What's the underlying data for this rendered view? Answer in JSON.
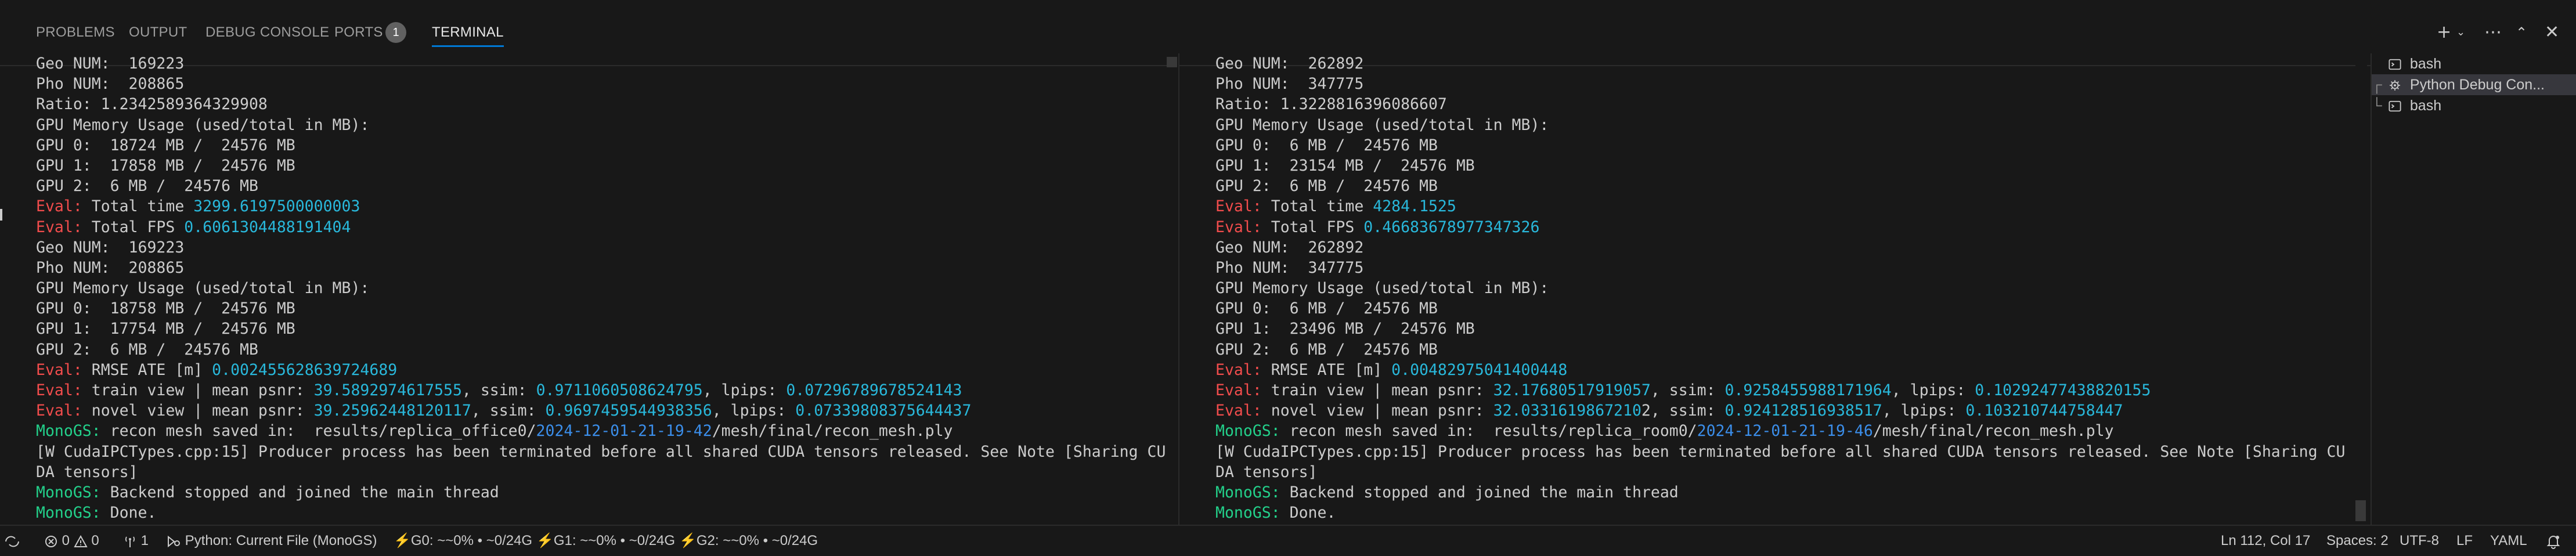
{
  "panel": {
    "tabs": [
      {
        "label": "PROBLEMS"
      },
      {
        "label": "OUTPUT"
      },
      {
        "label": "DEBUG CONSOLE"
      },
      {
        "label": "PORTS"
      },
      {
        "label": "TERMINAL"
      }
    ],
    "ports_badge": "1",
    "active_tab": "TERMINAL"
  },
  "terminal_left": {
    "lines": [
      {
        "segments": [
          {
            "text": "Geo NUM:  169223",
            "color": "default"
          }
        ]
      },
      {
        "segments": [
          {
            "text": "Pho NUM:  208865",
            "color": "default"
          }
        ]
      },
      {
        "segments": [
          {
            "text": "Ratio: 1.2342589364329908",
            "color": "default"
          }
        ]
      },
      {
        "segments": [
          {
            "text": "GPU Memory Usage (used/total in MB):",
            "color": "default"
          }
        ]
      },
      {
        "segments": [
          {
            "text": "GPU 0:  18724 MB /  24576 MB",
            "color": "default"
          }
        ]
      },
      {
        "segments": [
          {
            "text": "GPU 1:  17858 MB /  24576 MB",
            "color": "default"
          }
        ]
      },
      {
        "segments": [
          {
            "text": "GPU 2:  6 MB /  24576 MB",
            "color": "default"
          }
        ]
      },
      {
        "segments": [
          {
            "text": "Eval:",
            "color": "red"
          },
          {
            "text": " Total time ",
            "color": "default"
          },
          {
            "text": "3299.6197500000003",
            "color": "cyan"
          }
        ]
      },
      {
        "segments": [
          {
            "text": "Eval:",
            "color": "red"
          },
          {
            "text": " Total FPS ",
            "color": "default"
          },
          {
            "text": "0.6061304488191404",
            "color": "cyan"
          }
        ]
      },
      {
        "segments": [
          {
            "text": "Geo NUM:  169223",
            "color": "default"
          }
        ]
      },
      {
        "segments": [
          {
            "text": "Pho NUM:  208865",
            "color": "default"
          }
        ]
      },
      {
        "segments": [
          {
            "text": "GPU Memory Usage (used/total in MB):",
            "color": "default"
          }
        ]
      },
      {
        "segments": [
          {
            "text": "GPU 0:  18758 MB /  24576 MB",
            "color": "default"
          }
        ]
      },
      {
        "segments": [
          {
            "text": "GPU 1:  17754 MB /  24576 MB",
            "color": "default"
          }
        ]
      },
      {
        "segments": [
          {
            "text": "GPU 2:  6 MB /  24576 MB",
            "color": "default"
          }
        ]
      },
      {
        "segments": [
          {
            "text": "Eval:",
            "color": "red"
          },
          {
            "text": " RMSE ATE [m] ",
            "color": "default"
          },
          {
            "text": "0.002455628639724689",
            "color": "cyan"
          }
        ]
      },
      {
        "segments": [
          {
            "text": "Eval:",
            "color": "red"
          },
          {
            "text": " train view | mean psnr: ",
            "color": "default"
          },
          {
            "text": "39.5892974617555",
            "color": "cyan"
          },
          {
            "text": ", ssim: ",
            "color": "default"
          },
          {
            "text": "0.9711060508624795",
            "color": "cyan"
          },
          {
            "text": ", lpips: ",
            "color": "default"
          },
          {
            "text": "0.07296789678524143",
            "color": "cyan"
          }
        ]
      },
      {
        "segments": [
          {
            "text": "Eval:",
            "color": "red"
          },
          {
            "text": " novel view | mean psnr: ",
            "color": "default"
          },
          {
            "text": "39.25962448120117",
            "color": "cyan"
          },
          {
            "text": ", ssim: ",
            "color": "default"
          },
          {
            "text": "0.9697459544938356",
            "color": "cyan"
          },
          {
            "text": ", lpips: ",
            "color": "default"
          },
          {
            "text": "0.07339808375644437",
            "color": "cyan"
          }
        ]
      },
      {
        "segments": [
          {
            "text": "MonoGS:",
            "color": "green"
          },
          {
            "text": " recon mesh saved in:  results/replica_office0/",
            "color": "default"
          },
          {
            "text": "2024-12-01-21-19-42",
            "color": "blue"
          },
          {
            "text": "/mesh/final/recon_mesh.ply",
            "color": "default"
          }
        ]
      },
      {
        "segments": [
          {
            "text": "[W CudaIPCTypes.cpp:15] Producer process has been terminated before all shared CUDA tensors released. See Note [Sharing CU",
            "color": "default"
          }
        ]
      },
      {
        "segments": [
          {
            "text": "DA tensors]",
            "color": "default"
          }
        ]
      },
      {
        "segments": [
          {
            "text": "MonoGS:",
            "color": "green"
          },
          {
            "text": " Backend stopped and joined the main thread",
            "color": "default"
          }
        ]
      },
      {
        "segments": [
          {
            "text": "MonoGS:",
            "color": "green"
          },
          {
            "text": " Done.",
            "color": "default"
          }
        ]
      }
    ]
  },
  "terminal_right": {
    "lines": [
      {
        "segments": [
          {
            "text": "Geo NUM:  262892",
            "color": "default"
          }
        ]
      },
      {
        "segments": [
          {
            "text": "Pho NUM:  347775",
            "color": "default"
          }
        ]
      },
      {
        "segments": [
          {
            "text": "Ratio: 1.3228816396086607",
            "color": "default"
          }
        ]
      },
      {
        "segments": [
          {
            "text": "GPU Memory Usage (used/total in MB):",
            "color": "default"
          }
        ]
      },
      {
        "segments": [
          {
            "text": "GPU 0:  6 MB /  24576 MB",
            "color": "default"
          }
        ]
      },
      {
        "segments": [
          {
            "text": "GPU 1:  23154 MB /  24576 MB",
            "color": "default"
          }
        ]
      },
      {
        "segments": [
          {
            "text": "GPU 2:  6 MB /  24576 MB",
            "color": "default"
          }
        ]
      },
      {
        "segments": [
          {
            "text": "Eval:",
            "color": "red"
          },
          {
            "text": " Total time ",
            "color": "default"
          },
          {
            "text": "4284.1525",
            "color": "cyan"
          }
        ]
      },
      {
        "segments": [
          {
            "text": "Eval:",
            "color": "red"
          },
          {
            "text": " Total FPS ",
            "color": "default"
          },
          {
            "text": "0.46683678977347326",
            "color": "cyan"
          }
        ]
      },
      {
        "segments": [
          {
            "text": "Geo NUM:  262892",
            "color": "default"
          }
        ]
      },
      {
        "segments": [
          {
            "text": "Pho NUM:  347775",
            "color": "default"
          }
        ]
      },
      {
        "segments": [
          {
            "text": "GPU Memory Usage (used/total in MB):",
            "color": "default"
          }
        ]
      },
      {
        "segments": [
          {
            "text": "GPU 0:  6 MB /  24576 MB",
            "color": "default"
          }
        ]
      },
      {
        "segments": [
          {
            "text": "GPU 1:  23496 MB /  24576 MB",
            "color": "default"
          }
        ]
      },
      {
        "segments": [
          {
            "text": "GPU 2:  6 MB /  24576 MB",
            "color": "default"
          }
        ]
      },
      {
        "segments": [
          {
            "text": "Eval:",
            "color": "red"
          },
          {
            "text": " RMSE ATE [m] ",
            "color": "default"
          },
          {
            "text": "0.00482975041400448",
            "color": "cyan"
          }
        ]
      },
      {
        "segments": [
          {
            "text": "Eval:",
            "color": "red"
          },
          {
            "text": " train view | mean psnr: ",
            "color": "default"
          },
          {
            "text": "32.17680517919057",
            "color": "cyan"
          },
          {
            "text": ", ssim: ",
            "color": "default"
          },
          {
            "text": "0.9258455988171964",
            "color": "cyan"
          },
          {
            "text": ", lpips: ",
            "color": "default"
          },
          {
            "text": "0.10292477438820155",
            "color": "cyan"
          }
        ]
      },
      {
        "segments": [
          {
            "text": "Eval:",
            "color": "red"
          },
          {
            "text": " novel view | mean psnr: ",
            "color": "default"
          },
          {
            "text": "32.0331619867210",
            "color": "cyan"
          },
          {
            "text": "2, ssim: ",
            "color": "default"
          },
          {
            "text": "0.924128516938517",
            "color": "cyan"
          },
          {
            "text": ", lpips: ",
            "color": "default"
          },
          {
            "text": "0.103210744758447",
            "color": "cyan"
          }
        ]
      },
      {
        "segments": [
          {
            "text": "MonoGS:",
            "color": "green"
          },
          {
            "text": " recon mesh saved in:  results/replica_room0/",
            "color": "default"
          },
          {
            "text": "2024-12-01-21-19-46",
            "color": "blue"
          },
          {
            "text": "/mesh/final/recon_mesh.ply",
            "color": "default"
          }
        ]
      },
      {
        "segments": [
          {
            "text": "[W CudaIPCTypes.cpp:15] Producer process has been terminated before all shared CUDA tensors released. See Note [Sharing CU",
            "color": "default"
          }
        ]
      },
      {
        "segments": [
          {
            "text": "DA tensors]",
            "color": "default"
          }
        ]
      },
      {
        "segments": [
          {
            "text": "MonoGS:",
            "color": "green"
          },
          {
            "text": " Backend stopped and joined the main thread",
            "color": "default"
          }
        ]
      },
      {
        "segments": [
          {
            "text": "MonoGS:",
            "color": "green"
          },
          {
            "text": " Done.",
            "color": "default"
          }
        ]
      }
    ]
  },
  "sessions": [
    {
      "label": "bash",
      "icon": "terminal-icon",
      "prefix": ""
    },
    {
      "label": "Python Debug Con...",
      "icon": "debug-gear-icon",
      "prefix": "┌"
    },
    {
      "label": "bash",
      "icon": "terminal-icon",
      "prefix": "└"
    }
  ],
  "statusbar": {
    "errors": "0",
    "warnings": "0",
    "ports": "1",
    "debug_config": "Python: Current File (MonoGS)",
    "gpu0": "G0: ~~0% • ~0/24G",
    "gpu1": "G1: ~~0% • ~0/24G",
    "gpu2": "G2: ~~0% • ~0/24G",
    "cursor": "Ln 112, Col 17",
    "indent": "Spaces: 2",
    "encoding": "UTF-8",
    "eol": "LF",
    "language": "YAML"
  },
  "colors": {
    "accent": "#0078d4",
    "red": "#f14c4c",
    "green": "#23d18b",
    "blue": "#3b8eea",
    "cyan": "#29b8db"
  }
}
